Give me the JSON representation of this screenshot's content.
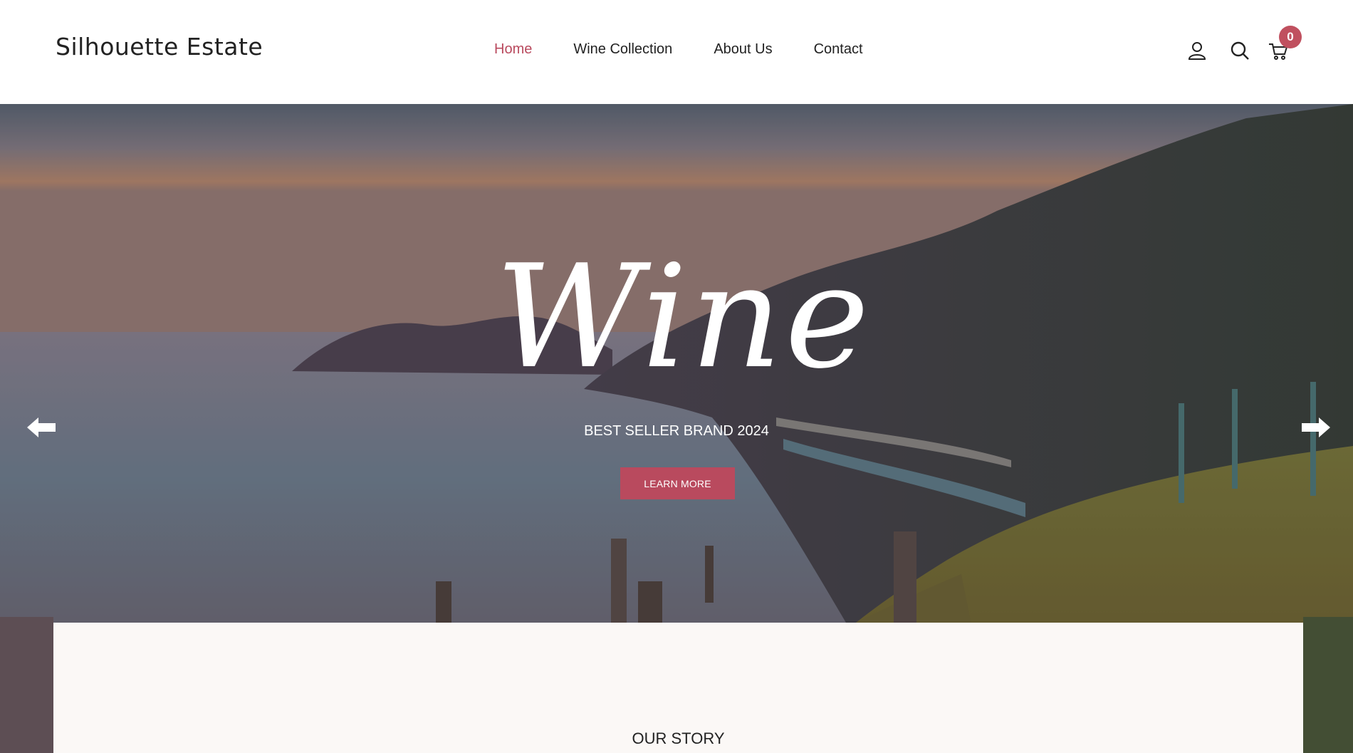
{
  "brand": {
    "name": "Silhouette Estate"
  },
  "nav": {
    "items": [
      {
        "label": "Home",
        "active": true
      },
      {
        "label": "Wine Collection",
        "active": false
      },
      {
        "label": "About Us",
        "active": false
      },
      {
        "label": "Contact",
        "active": false
      }
    ]
  },
  "header_icons": {
    "account": "user-icon",
    "search": "search-icon",
    "cart": "cart-icon",
    "cart_count": "0"
  },
  "hero": {
    "title": "Wine",
    "subtitle": "BEST SELLER BRAND 2024",
    "button_label": "LEARN MORE",
    "prev_icon": "arrow-left-icon",
    "next_icon": "arrow-right-icon"
  },
  "story": {
    "title": "OUR STORY"
  },
  "colors": {
    "accent": "#b94a5e",
    "badge": "#c0505f",
    "text": "#222222",
    "panel": "#fbf8f6"
  }
}
